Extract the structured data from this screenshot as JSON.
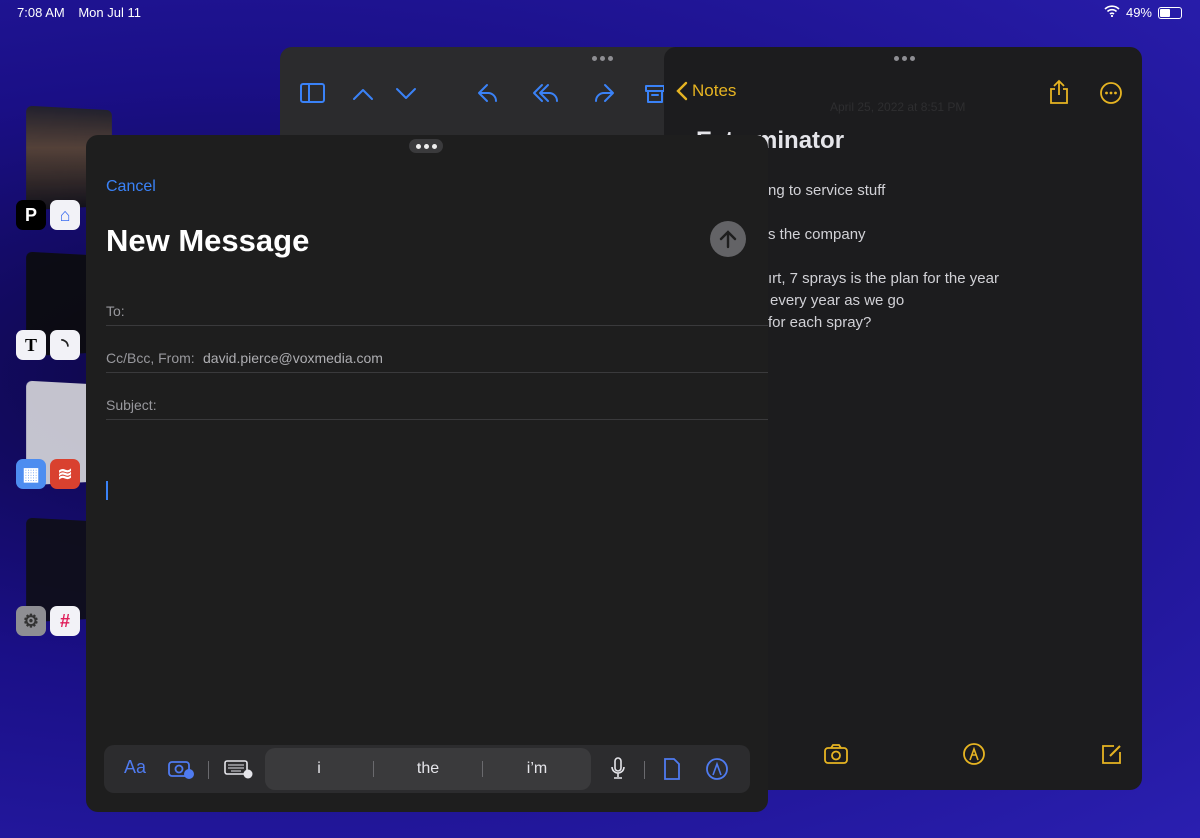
{
  "status": {
    "time": "7:08 AM",
    "date": "Mon Jul 11",
    "battery": "49%",
    "battery_level": 0.49
  },
  "switcher": [
    {
      "apps": [
        "Plex",
        "Twelve South"
      ]
    },
    {
      "apps": [
        "The New York Times",
        "RSS Reader"
      ]
    },
    {
      "apps": [
        "Fantastical",
        "Todoist"
      ]
    },
    {
      "apps": [
        "Settings",
        "Slack"
      ]
    }
  ],
  "notes": {
    "back_label": "Notes",
    "date": "April 25, 2022 at 8:51 PM",
    "title": "Exterminator",
    "lines": [
      "ng to service stuff",
      "s the company",
      "ırt, 7 sprays is the plan for the year",
      "every year as we go",
      "for each spray?"
    ]
  },
  "compose": {
    "cancel": "Cancel",
    "title": "New Message",
    "to_label": "To:",
    "ccbcc_label": "Cc/Bcc, From:",
    "from": "david.pierce@voxmedia.com",
    "subject_label": "Subject:",
    "format_label": "Aa",
    "suggestions": [
      "i",
      "the",
      "i’m"
    ]
  },
  "colors": {
    "mail_accent": "#3a82f7",
    "notes_accent": "#e6b422"
  }
}
